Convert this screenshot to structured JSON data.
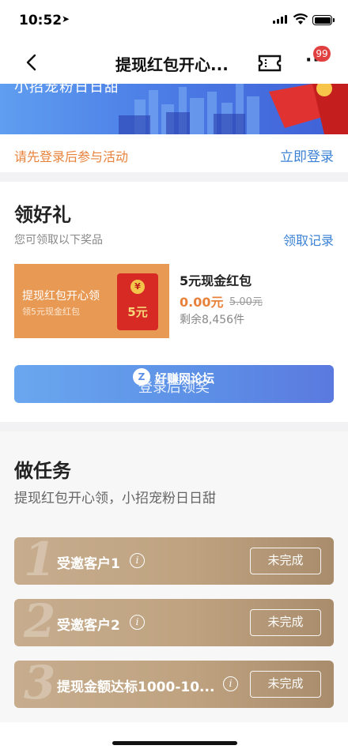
{
  "status_bar": {
    "time": "10:52"
  },
  "nav": {
    "title": "提现红包开心...",
    "badge": "99"
  },
  "banner": {
    "text": "小招宠粉日日甜"
  },
  "login": {
    "hint": "请先登录后参与活动",
    "link": "立即登录"
  },
  "gifts": {
    "title": "领好礼",
    "subtitle": "您可领取以下奖品",
    "record_link": "领取记录",
    "card": {
      "title": "提现红包开心领",
      "subtitle": "领5元现金红包",
      "coin": "¥",
      "envelope_amount": "5元"
    },
    "prize": {
      "name": "5元现金红包",
      "price": "0.00元",
      "original_price": "5.00元",
      "remaining": "剩余8,456件"
    },
    "claim_button": "登录后领奖",
    "watermark": "好赚网论坛"
  },
  "tasks": {
    "title": "做任务",
    "subtitle": "提现红包开心领，小招宠粉日日甜",
    "items": [
      {
        "num": "1",
        "name": "受邀客户1",
        "status": "未完成"
      },
      {
        "num": "2",
        "name": "受邀客户2",
        "status": "未完成"
      },
      {
        "num": "3",
        "name": "提现金额达标1000-10...",
        "status": "未完成"
      }
    ]
  }
}
